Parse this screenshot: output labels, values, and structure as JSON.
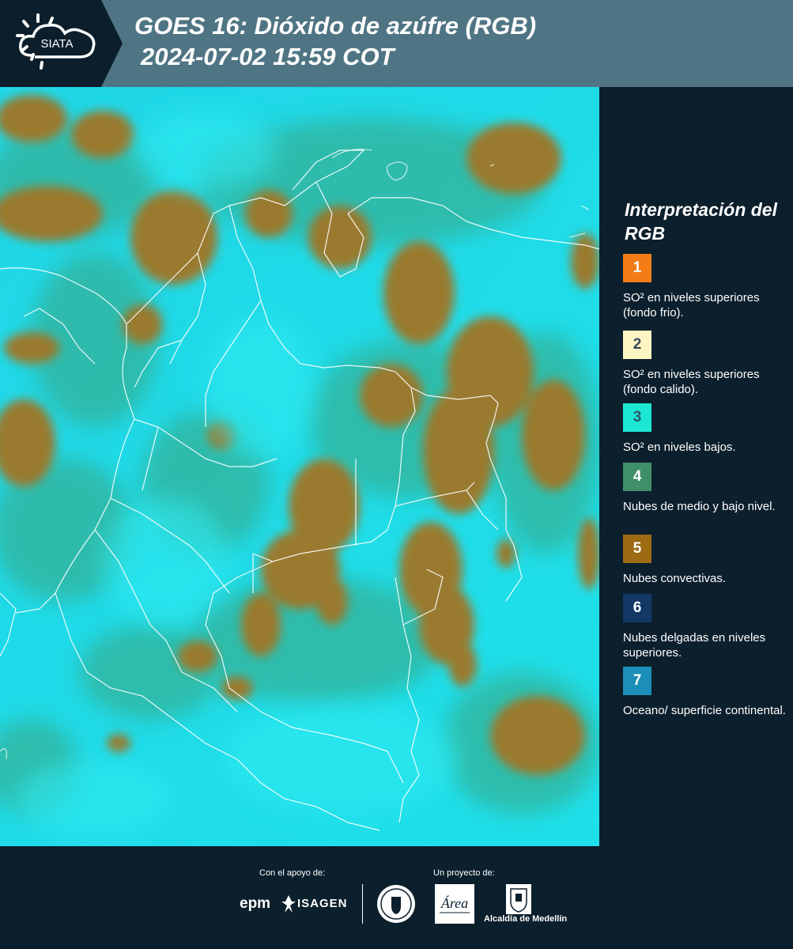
{
  "header": {
    "logo_text": "SIATA",
    "title": "GOES 16: Dióxido de azúfre (RGB)",
    "subtitle": "2024-07-02 15:59 COT"
  },
  "legend": {
    "title": "Interpretación del RGB",
    "items": [
      {
        "number": "1",
        "color": "#f47c17",
        "text": "SO² en niveles superiores (fondo frio)."
      },
      {
        "number": "2",
        "color": "#fdf6c3",
        "text": "SO² en niveles superiores (fondo calido)."
      },
      {
        "number": "3",
        "color": "#1de6d3",
        "text": "SO² en niveles bajos."
      },
      {
        "number": "4",
        "color": "#3f8f68",
        "text": "Nubes de medio y bajo nivel."
      },
      {
        "number": "5",
        "color": "#9d6b12",
        "text": "Nubes convectivas."
      },
      {
        "number": "6",
        "color": "#123866",
        "text": "Nubes delgadas en niveles superiores."
      },
      {
        "number": "7",
        "color": "#1c8fb8",
        "text": "Oceano/ superficie continental."
      }
    ]
  },
  "footer": {
    "support_label": "Con el apoyo de:",
    "project_label": "Un proyecto de:",
    "epm_logo": "epm",
    "isagen_logo": "ISAGEN",
    "area_logo": "Área Metropolitana Valle de Aburrá",
    "medellin_logo": "Alcaldía de Medellín"
  }
}
